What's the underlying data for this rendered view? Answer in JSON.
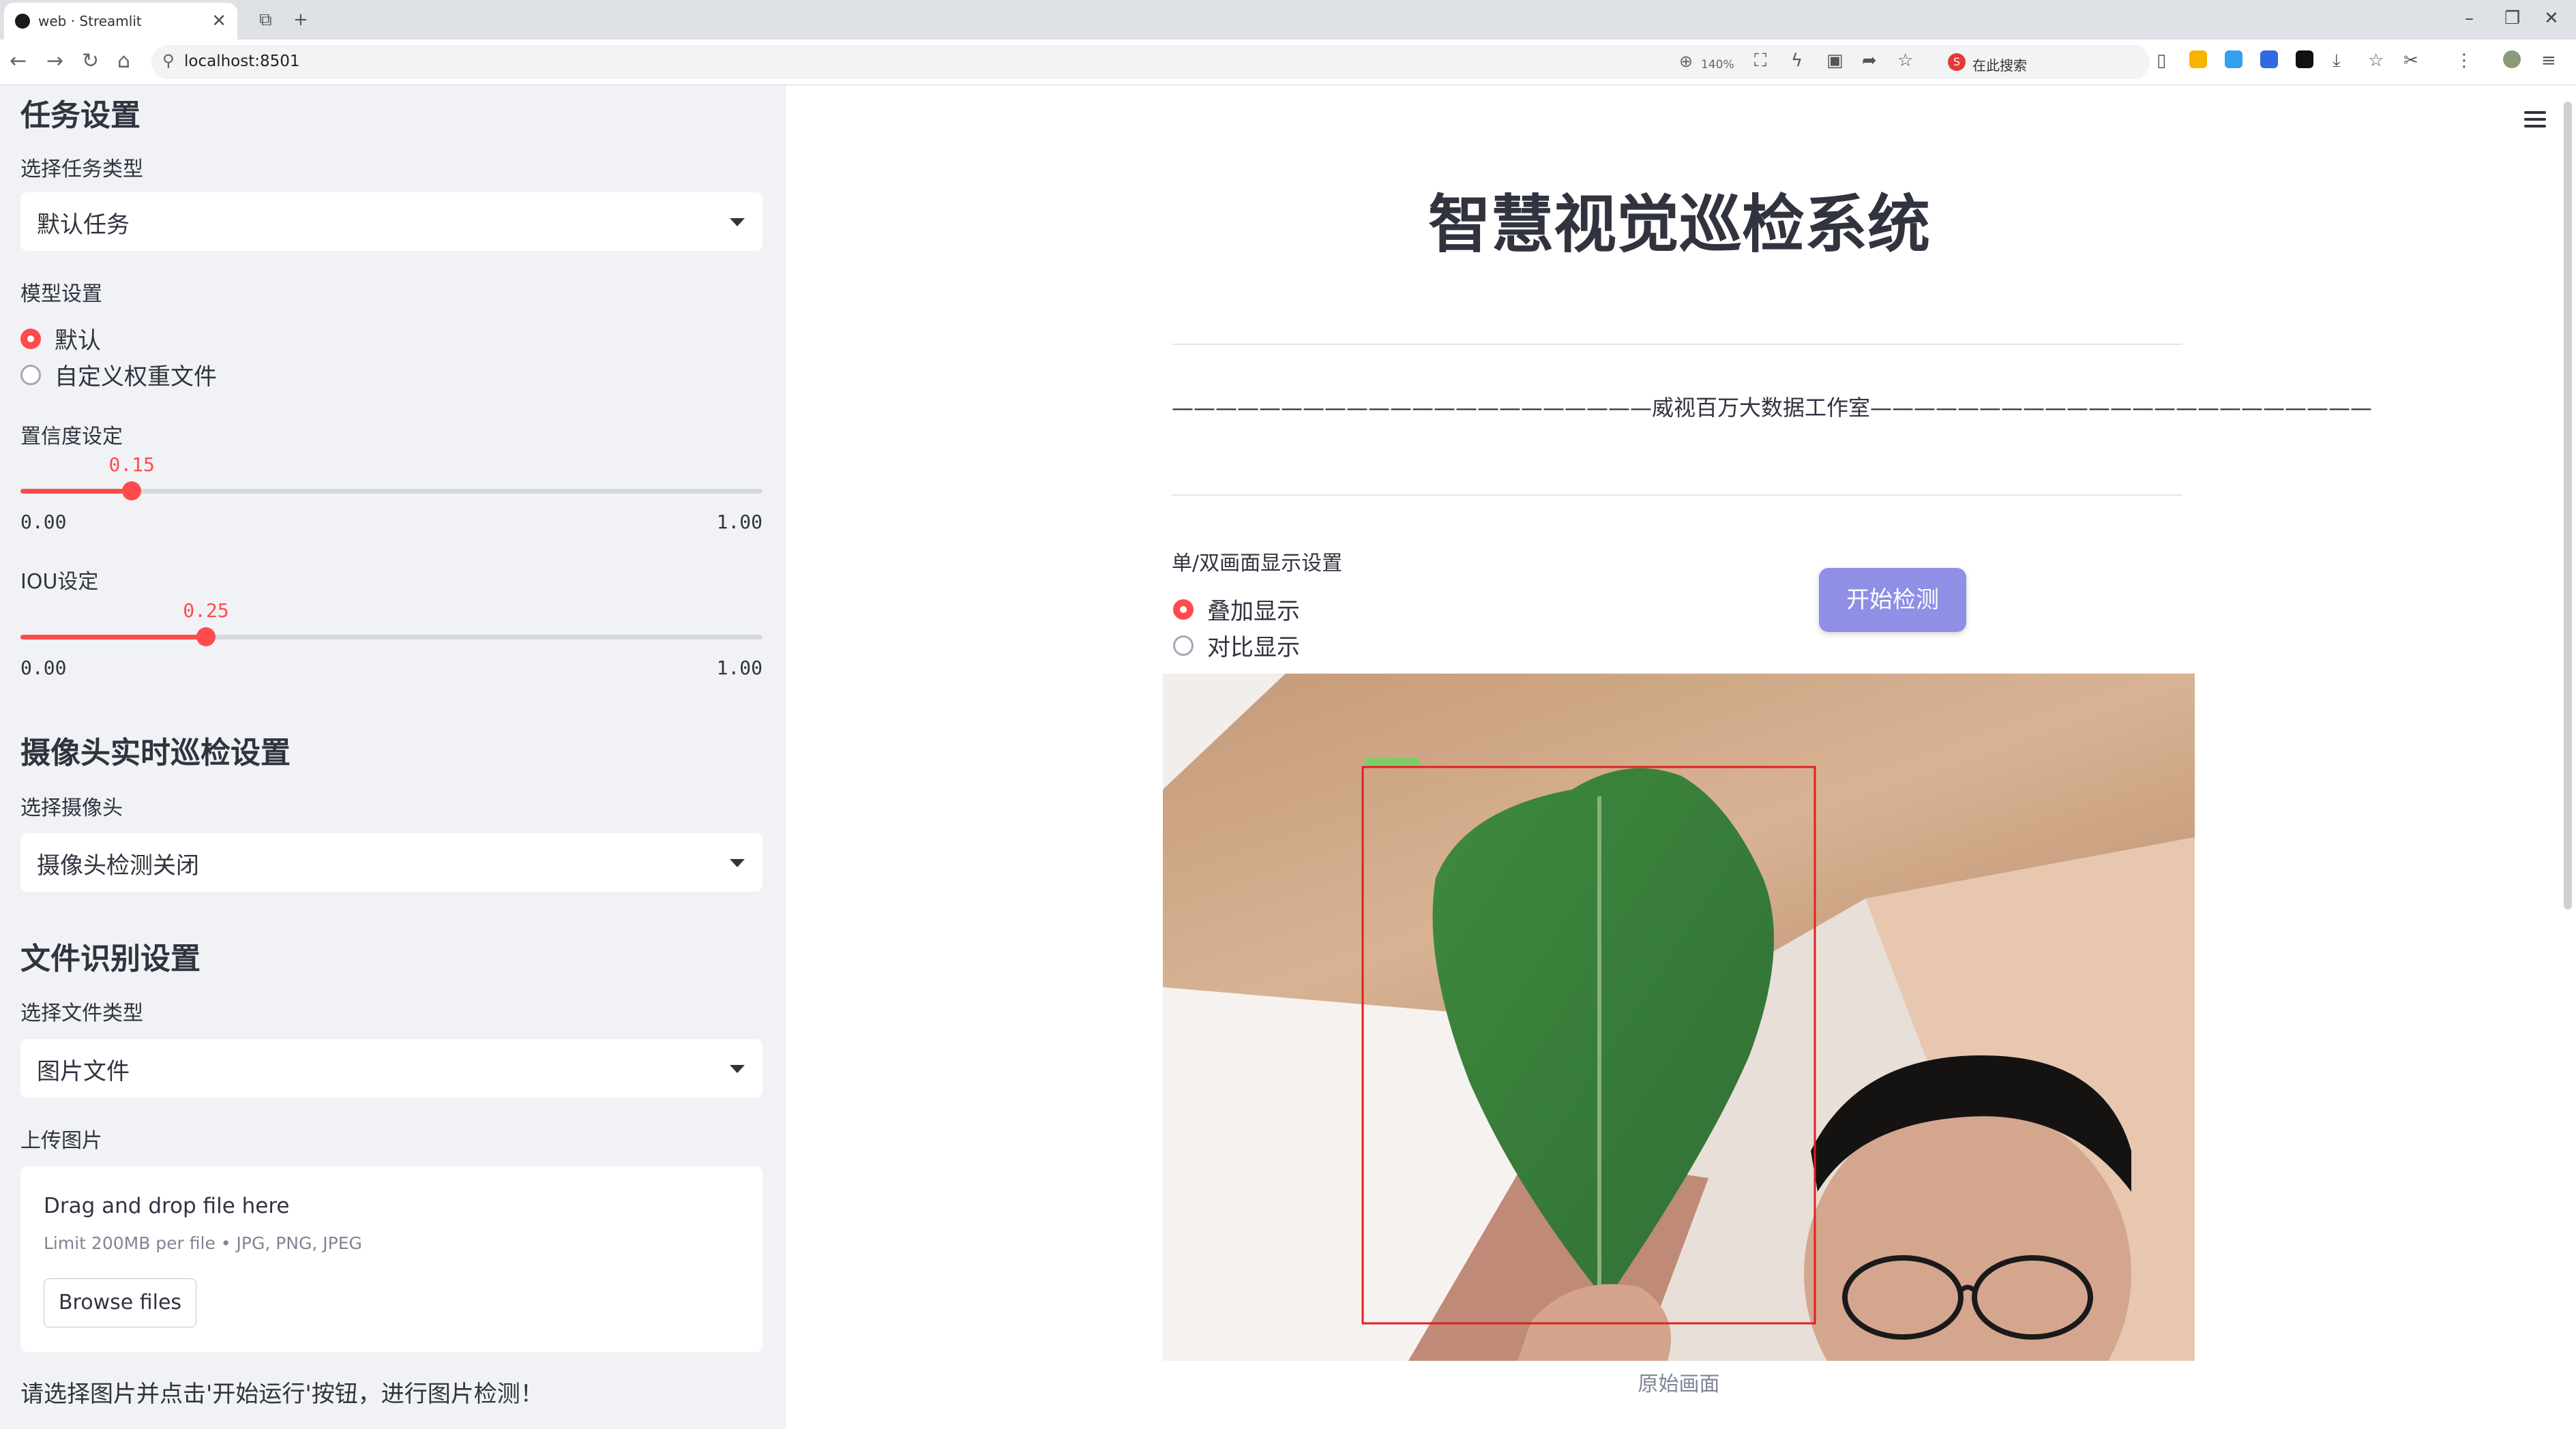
{
  "browser": {
    "tab_title": "web · Streamlit",
    "url": "localhost:8501",
    "zoom": "140%",
    "search_placeholder": "在此搜索"
  },
  "sidebar": {
    "task_heading": "任务设置",
    "task_type_label": "选择任务类型",
    "task_type_value": "默认任务",
    "model_label": "模型设置",
    "model_options": [
      "默认",
      "自定义权重文件"
    ],
    "model_selected": "默认",
    "confidence": {
      "label": "置信度设定",
      "value": "0.15",
      "value_num": 0.15,
      "min": "0.00",
      "max": "1.00"
    },
    "iou": {
      "label": "IOU设定",
      "value": "0.25",
      "value_num": 0.25,
      "min": "0.00",
      "max": "1.00"
    },
    "camera_heading": "摄像头实时巡检设置",
    "camera_label": "选择摄像头",
    "camera_value": "摄像头检测关闭",
    "file_heading": "文件识别设置",
    "file_type_label": "选择文件类型",
    "file_type_value": "图片文件",
    "upload_label": "上传图片",
    "drop_title": "Drag and drop file here",
    "drop_limit": "Limit 200MB per file • JPG, PNG, JPEG",
    "browse_label": "Browse files",
    "hint": "请选择图片并点击'开始运行'按钮，进行图片检测！"
  },
  "main": {
    "title": "智慧视觉巡检系统",
    "subtitle": "——————————————————————威视百万大数据工作室———————————————————————",
    "display_label": "单/双画面显示设置",
    "display_options": [
      "叠加显示",
      "对比显示"
    ],
    "display_selected": "叠加显示",
    "start_button": "开始检测",
    "image_caption": "原始画面"
  },
  "colors": {
    "accent": "#ff4b4b",
    "sidebar_bg": "#f0f2f6",
    "button": "#8f8fe6",
    "detection_box": "#e02020"
  }
}
